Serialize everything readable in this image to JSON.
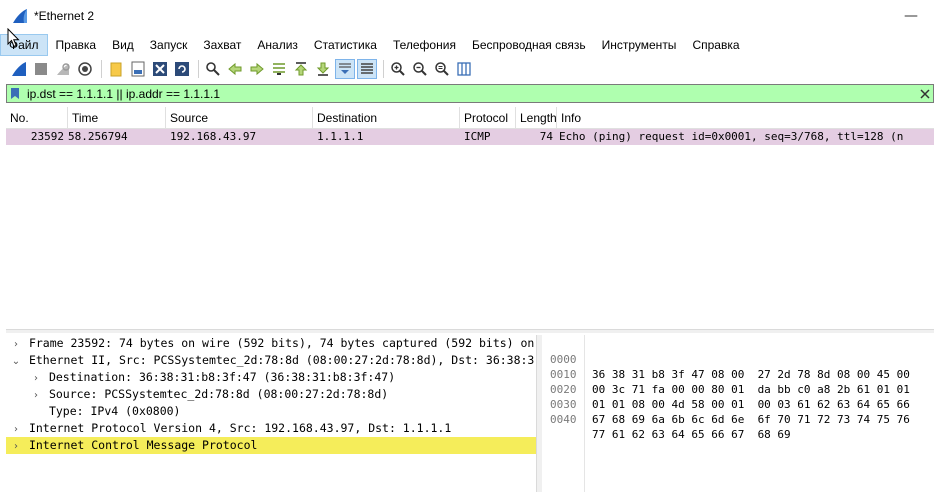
{
  "window": {
    "title": "*Ethernet 2",
    "minimize_glyph": "—"
  },
  "menu": [
    "Файл",
    "Правка",
    "Вид",
    "Запуск",
    "Захват",
    "Анализ",
    "Статистика",
    "Телефония",
    "Беспроводная связь",
    "Инструменты",
    "Справка"
  ],
  "toolbar": {
    "icons": [
      "shark-fin-start-icon",
      "stop-square-icon",
      "restart-icon",
      "capture-options-icon",
      "open-folder-icon",
      "save-file-icon",
      "close-file-icon",
      "reload-icon",
      "find-packet-icon",
      "go-back-icon",
      "go-forward-icon",
      "go-to-packet-icon",
      "first-packet-icon",
      "last-packet-icon",
      "autoscroll-icon",
      "colorize-icon",
      "zoom-in-icon",
      "zoom-out-icon",
      "normal-size-icon",
      "resize-columns-icon"
    ]
  },
  "filter": {
    "value": "ip.dst == 1.1.1.1 || ip.addr == 1.1.1.1",
    "bg_color": "#afffaf"
  },
  "packet_list": {
    "columns": [
      "No.",
      "Time",
      "Source",
      "Destination",
      "Protocol",
      "Length",
      "Info"
    ],
    "rows": [
      {
        "no": "23592",
        "time": "58.256794",
        "source": "192.168.43.97",
        "destination": "1.1.1.1",
        "protocol": "ICMP",
        "length": "74",
        "info": "Echo (ping) request  id=0x0001, seq=3/768, ttl=128 (n",
        "color": "#e4cde2"
      }
    ]
  },
  "details": [
    {
      "indent": 0,
      "arrow": "›",
      "text": "Frame 23592: 74 bytes on wire (592 bits), 74 bytes captured (592 bits) on"
    },
    {
      "indent": 0,
      "arrow": "⌄",
      "text": "Ethernet II, Src: PCSSystemtec_2d:78:8d (08:00:27:2d:78:8d), Dst: 36:38:3"
    },
    {
      "indent": 1,
      "arrow": "›",
      "text": "Destination: 36:38:31:b8:3f:47 (36:38:31:b8:3f:47)"
    },
    {
      "indent": 1,
      "arrow": "›",
      "text": "Source: PCSSystemtec_2d:78:8d (08:00:27:2d:78:8d)"
    },
    {
      "indent": 1,
      "arrow": "",
      "text": "Type: IPv4 (0x0800)"
    },
    {
      "indent": 0,
      "arrow": "›",
      "text": "Internet Protocol Version 4, Src: 192.168.43.97, Dst: 1.1.1.1"
    },
    {
      "indent": 0,
      "arrow": "›",
      "text": "Internet Control Message Protocol",
      "selected": true
    }
  ],
  "hex": [
    {
      "offset": "0000",
      "bytes": "36 38 31 b8 3f 47 08 00  27 2d 78 8d 08 00 45 00"
    },
    {
      "offset": "0010",
      "bytes": "00 3c 71 fa 00 00 80 01  da bb c0 a8 2b 61 01 01"
    },
    {
      "offset": "0020",
      "bytes": "01 01 08 00 4d 58 00 01  00 03 61 62 63 64 65 66"
    },
    {
      "offset": "0030",
      "bytes": "67 68 69 6a 6b 6c 6d 6e  6f 70 71 72 73 74 75 76"
    },
    {
      "offset": "0040",
      "bytes": "77 61 62 63 64 65 66 67  68 69"
    }
  ]
}
